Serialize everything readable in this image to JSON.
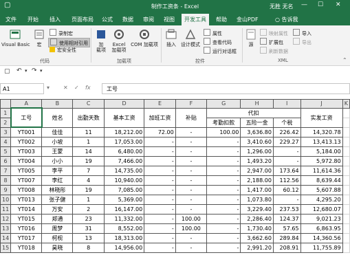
{
  "window": {
    "title": "制作工资条 - Excel",
    "user": "无胜 无名",
    "buttons": [
      "—",
      "☐",
      "✕"
    ]
  },
  "ribbon_tabs": [
    "文件",
    "开始",
    "插入",
    "页面布局",
    "公式",
    "数据",
    "审阅",
    "视图",
    "开发工具",
    "帮助",
    "金山PDF",
    "告诉我"
  ],
  "active_tab": "开发工具",
  "ribbon": {
    "code": {
      "label": "代码",
      "visual_basic": "Visual Basic",
      "macros": "宏",
      "record": "录制宏",
      "relative": "使用相对引用",
      "security": "宏安全性"
    },
    "addins": {
      "label": "加载项",
      "addins": "加\n载项",
      "excel_addins": "Excel\n加载项",
      "com_addins": "COM 加载项"
    },
    "controls": {
      "label": "控件",
      "insert": "插入",
      "design": "设计模式",
      "properties": "属性",
      "view_code": "查看代码",
      "run_dialog": "运行对话框"
    },
    "xml": {
      "label": "XML",
      "source": "源",
      "map_props": "映射属性",
      "expansion": "扩展包",
      "refresh": "刷新数据",
      "import": "导入",
      "export": "导出"
    }
  },
  "name_box": "A1",
  "formula_value": "工号",
  "columns": [
    "A",
    "B",
    "C",
    "D",
    "E",
    "F",
    "G",
    "H",
    "I",
    "J",
    "K"
  ],
  "header_row1": {
    "a": "工号",
    "b": "姓名",
    "c": "出勤天数",
    "d": "基本工资",
    "e": "加班工资",
    "f": "补贴",
    "gi": "代扣",
    "j": "实发工资"
  },
  "header_row2": {
    "g": "考勤扣款",
    "h": "五险一金",
    "i": "个税"
  },
  "rows": [
    [
      "YT001",
      "佳佳",
      "11",
      "18,212.00",
      "72.00",
      "-",
      "100.00",
      "3,636.80",
      "226.42",
      "14,320.78"
    ],
    [
      "YT002",
      "小坡",
      "1",
      "17,053.00",
      "-",
      "-",
      "-",
      "3,410.60",
      "229.27",
      "13,413.13"
    ],
    [
      "YT003",
      "王蒙",
      "14",
      "6,480.00",
      "-",
      "-",
      "-",
      "1,296.00",
      "-",
      "5,184.00"
    ],
    [
      "YT004",
      "小小",
      "19",
      "7,466.00",
      "-",
      "-",
      "-",
      "1,493.20",
      "-",
      "5,972.80"
    ],
    [
      "YT005",
      "李平",
      "7",
      "14,735.00",
      "-",
      "-",
      "-",
      "2,947.00",
      "173.64",
      "11,614.36"
    ],
    [
      "YT007",
      "李红",
      "4",
      "10,940.00",
      "-",
      "-",
      "-",
      "2,188.00",
      "112.56",
      "8,639.44"
    ],
    [
      "YT008",
      "林晓彤",
      "19",
      "7,085.00",
      "-",
      "-",
      "-",
      "1,417.00",
      "60.12",
      "5,607.88"
    ],
    [
      "YT013",
      "张子健",
      "1",
      "5,369.00",
      "-",
      "-",
      "-",
      "1,073.80",
      "-",
      "4,295.20"
    ],
    [
      "YT014",
      "万安",
      "2",
      "16,147.00",
      "-",
      "-",
      "-",
      "3,229.40",
      "237.53",
      "12,680.07"
    ],
    [
      "YT015",
      "郑通",
      "23",
      "11,332.00",
      "-",
      "100.00",
      "-",
      "2,286.40",
      "124.37",
      "9,021.23"
    ],
    [
      "YT016",
      "周梦",
      "31",
      "8,552.00",
      "-",
      "100.00",
      "-",
      "1,730.40",
      "57.65",
      "6,863.95"
    ],
    [
      "YT017",
      "柯枧",
      "13",
      "18,313.00",
      "-",
      "-",
      "-",
      "3,662.60",
      "289.84",
      "14,360.56"
    ],
    [
      "YT018",
      "昊晓",
      "8",
      "14,956.00",
      "-",
      "-",
      "-",
      "2,991.20",
      "208.91",
      "11,755.89"
    ]
  ],
  "colors": {
    "brand": "#217346",
    "ribbon_bg": "#f3f3f3",
    "header_bg": "#e6e6e6"
  }
}
